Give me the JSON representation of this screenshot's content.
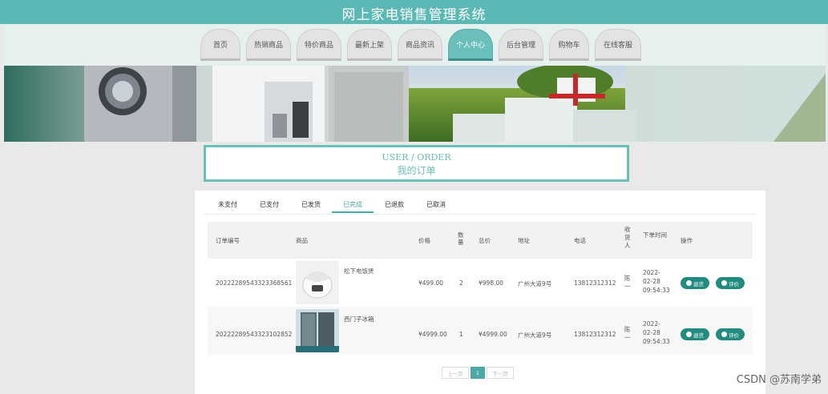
{
  "app": {
    "title": "网上家电销售管理系统"
  },
  "nav": {
    "items": [
      {
        "label": "首页"
      },
      {
        "label": "热销商品"
      },
      {
        "label": "特价商品"
      },
      {
        "label": "最新上架"
      },
      {
        "label": "商品资讯"
      },
      {
        "label": "个人中心"
      },
      {
        "label": "后台管理"
      },
      {
        "label": "购物车"
      },
      {
        "label": "在线客服"
      }
    ],
    "active": "个人中心"
  },
  "section": {
    "title_en": "USER / ORDER",
    "title_cn": "我的订单"
  },
  "tabs": {
    "items": [
      {
        "label": "未支付"
      },
      {
        "label": "已支付"
      },
      {
        "label": "已发货"
      },
      {
        "label": "已完成"
      },
      {
        "label": "已退款"
      },
      {
        "label": "已取消"
      }
    ],
    "active": "已完成"
  },
  "table": {
    "headers": {
      "order_no": "订单编号",
      "product": "商品",
      "price": "价格",
      "qty": "数量",
      "total": "总价",
      "address": "地址",
      "phone": "电话",
      "receiver": "收货人",
      "time": "下单时间",
      "actions": "操作"
    },
    "rows": [
      {
        "order_no": "20222289543323368561",
        "product_name": "松下电饭煲",
        "product_icon": "rice-cooker-image",
        "price": "¥499.00",
        "qty": "2",
        "total": "¥998.00",
        "address": "广州大道9号",
        "phone": "13812312312",
        "receiver": "陈一",
        "time": "2022-02-28 09:54:33",
        "refund_label": "退货",
        "review_label": "评价"
      },
      {
        "order_no": "20222289543323102852",
        "product_name": "西门子冰箱",
        "product_icon": "refrigerator-image",
        "price": "¥4999.00",
        "qty": "1",
        "total": "¥4999.00",
        "address": "广州大道9号",
        "phone": "13812312312",
        "receiver": "陈一",
        "time": "2022-02-28 09:54:33",
        "refund_label": "退货",
        "review_label": "评价"
      }
    ]
  },
  "pager": {
    "prev": "上一页",
    "current": "1",
    "next": "下一页"
  },
  "watermark": "CSDN @苏南学弟",
  "colors": {
    "accent": "#5cb8b4",
    "button": "#218c7e",
    "active_nav": "#6abfbb"
  }
}
